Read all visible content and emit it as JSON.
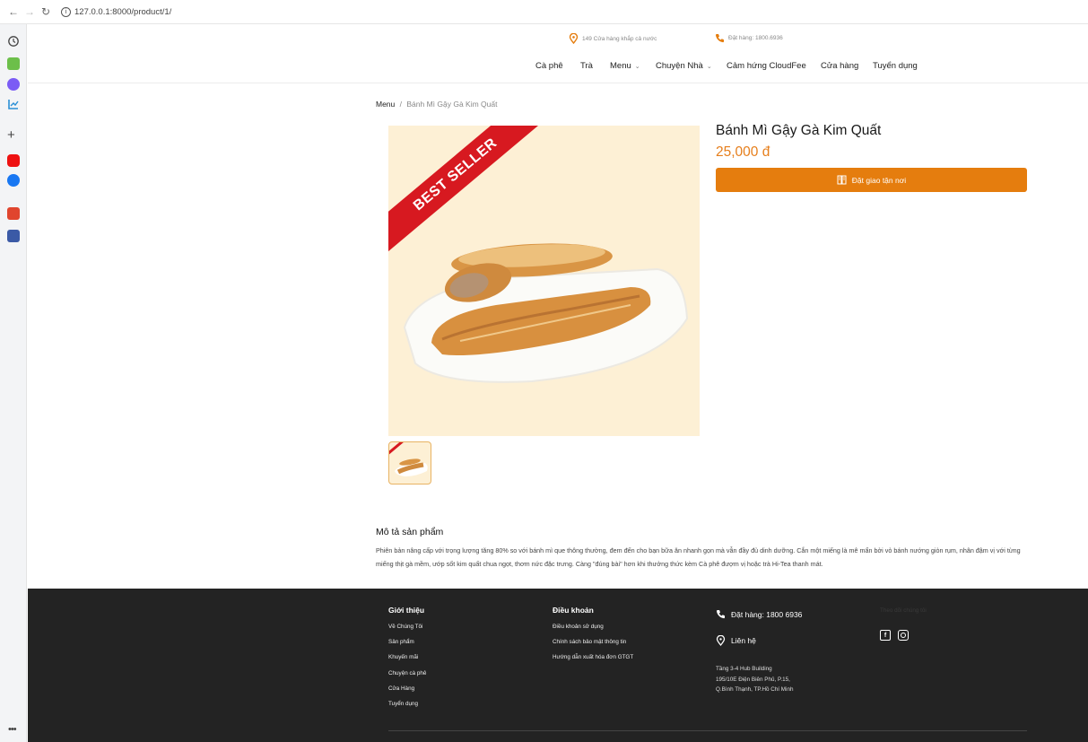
{
  "browser": {
    "url": "127.0.0.1:8000/product/1/"
  },
  "top_info": {
    "stores": "149 Cửa hàng khắp cả nước",
    "hotline": "Đặt hàng: 1800.6936"
  },
  "nav": {
    "items": [
      {
        "label": "Cà phê"
      },
      {
        "label": "Trà"
      },
      {
        "label": "Menu"
      },
      {
        "label": "Chuyện Nhà"
      },
      {
        "label": "Cảm hứng CloudFee"
      },
      {
        "label": "Cửa hàng"
      },
      {
        "label": "Tuyển dụng"
      }
    ]
  },
  "breadcrumb": {
    "root": "Menu",
    "separator": "/",
    "current": "Bánh Mì Gậy Gà Kim Quất"
  },
  "product": {
    "badge": "BEST SELLER",
    "name": "Bánh Mì Gậy Gà Kim Quất",
    "price": "25,000 đ",
    "order_label": "Đặt giao tận nơi"
  },
  "description": {
    "title": "Mô tả sản phẩm",
    "text": "Phiên bản nâng cấp với trọng lượng tăng 80% so với bánh mì que thông thường, đem đến cho bạn bữa ăn nhanh gọn mà vẫn đầy đủ dinh dưỡng. Cắn một miếng là mê mẩn bởi vỏ bánh nướng giòn rụm, nhân đậm vị với từng miếng thịt gà mềm, ướp sốt kim quất chua ngọt, thơm nức đặc trưng. Càng \"đúng bài\" hơn khi thưởng thức kèm Cà phê đượm vị hoặc trà Hi-Tea thanh mát."
  },
  "footer": {
    "intro_title": "Giới thiệu",
    "intro_links": [
      "Về Chúng Tôi",
      "Sản phẩm",
      "Khuyến mãi",
      "Chuyện cà phê",
      "Cửa Hàng",
      "Tuyển dụng"
    ],
    "terms_title": "Điều khoản",
    "terms_links": [
      "Điều khoản sử dụng",
      "Chính sách bảo mật thông tin",
      "Hướng dẫn xuất hóa đơn GTGT"
    ],
    "phone": "Đặt hàng: 1800 6936",
    "contact": "Liên hệ",
    "address_lines": [
      "Tầng 3-4 Hub Building",
      "195/10E Điện Biên Phủ, P.15,",
      "Q.Bình Thạnh, TP.Hồ Chí Minh"
    ],
    "follow": "Theo dõi chúng tôi"
  },
  "colors": {
    "accent": "#e57d0e",
    "price": "#e67e1b",
    "badge": "#d71920",
    "footer_bg": "#232323"
  }
}
